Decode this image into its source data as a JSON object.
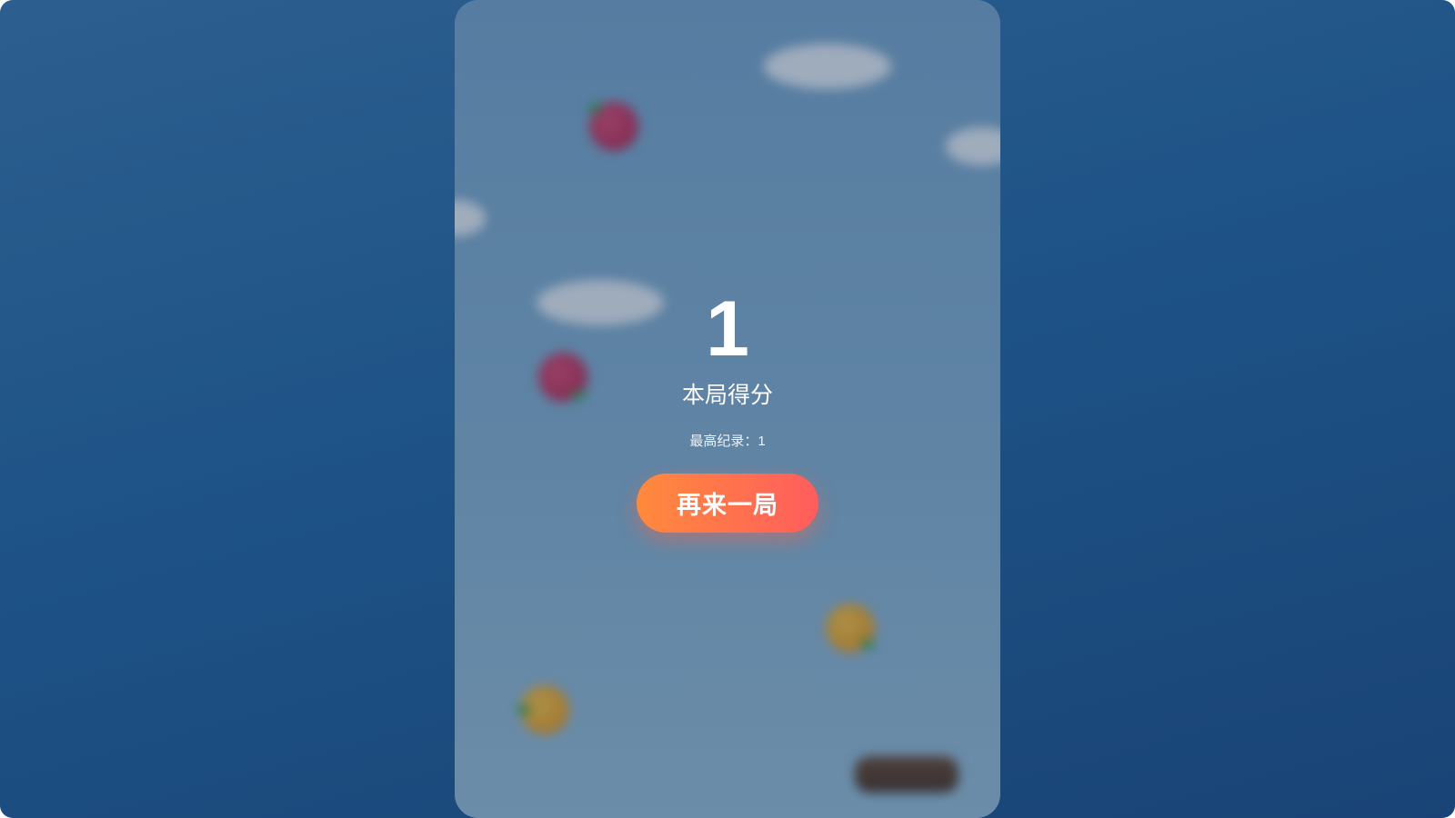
{
  "game_over": {
    "score": "1",
    "score_label": "本局得分",
    "best_record": "最高纪录：1",
    "replay_label": "再来一局"
  },
  "scene": {
    "fruits": [
      {
        "kind": "red",
        "icon": "red-fruit-icon"
      },
      {
        "kind": "red",
        "icon": "red-fruit-icon"
      },
      {
        "kind": "orange",
        "icon": "orange-fruit-icon"
      },
      {
        "kind": "orange",
        "icon": "orange-fruit-icon"
      }
    ],
    "colors": {
      "background": "#2466a0",
      "button_start": "#ff8a3c",
      "button_end": "#ff5d5d"
    }
  }
}
